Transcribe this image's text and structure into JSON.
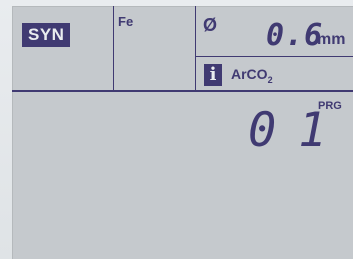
{
  "status": {
    "mode_label": "SYN",
    "material_label": "Fe",
    "diameter_symbol": "Ø",
    "wire_diameter": "0.6",
    "wire_unit": "mm",
    "info_symbol": "i",
    "gas_main": "ArCO",
    "gas_sub": "2"
  },
  "program": {
    "number": "01",
    "label": "PRG"
  },
  "colors": {
    "lcd_bg": "#c5c9cd",
    "ink": "#403a72",
    "frame": "#e9ecef"
  }
}
